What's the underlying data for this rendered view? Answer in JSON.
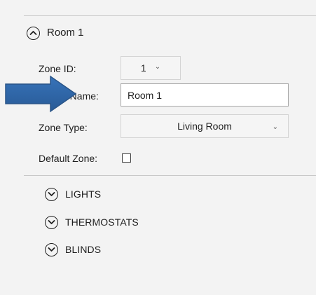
{
  "room": {
    "header": "Room 1",
    "header_icon": "chevron-up-circle-icon"
  },
  "fields": {
    "zone_id": {
      "label": "Zone ID:",
      "value": "1"
    },
    "zone_name": {
      "label": "Zone Name:",
      "visible_label": "e Name:",
      "value": "Room 1"
    },
    "zone_type": {
      "label": "Zone Type:",
      "value": "Living Room"
    },
    "default_zone": {
      "label": "Default Zone:",
      "checked": false
    }
  },
  "subsections": [
    {
      "label": "LIGHTS",
      "icon": "chevron-down-circle-icon"
    },
    {
      "label": "THERMOSTATS",
      "icon": "chevron-down-circle-icon"
    },
    {
      "label": "BLINDS",
      "icon": "chevron-down-circle-icon"
    }
  ],
  "colors": {
    "arrow": "#2e5f9a",
    "panel_bg": "#f3f3f3",
    "text": "#1f1f1f"
  }
}
